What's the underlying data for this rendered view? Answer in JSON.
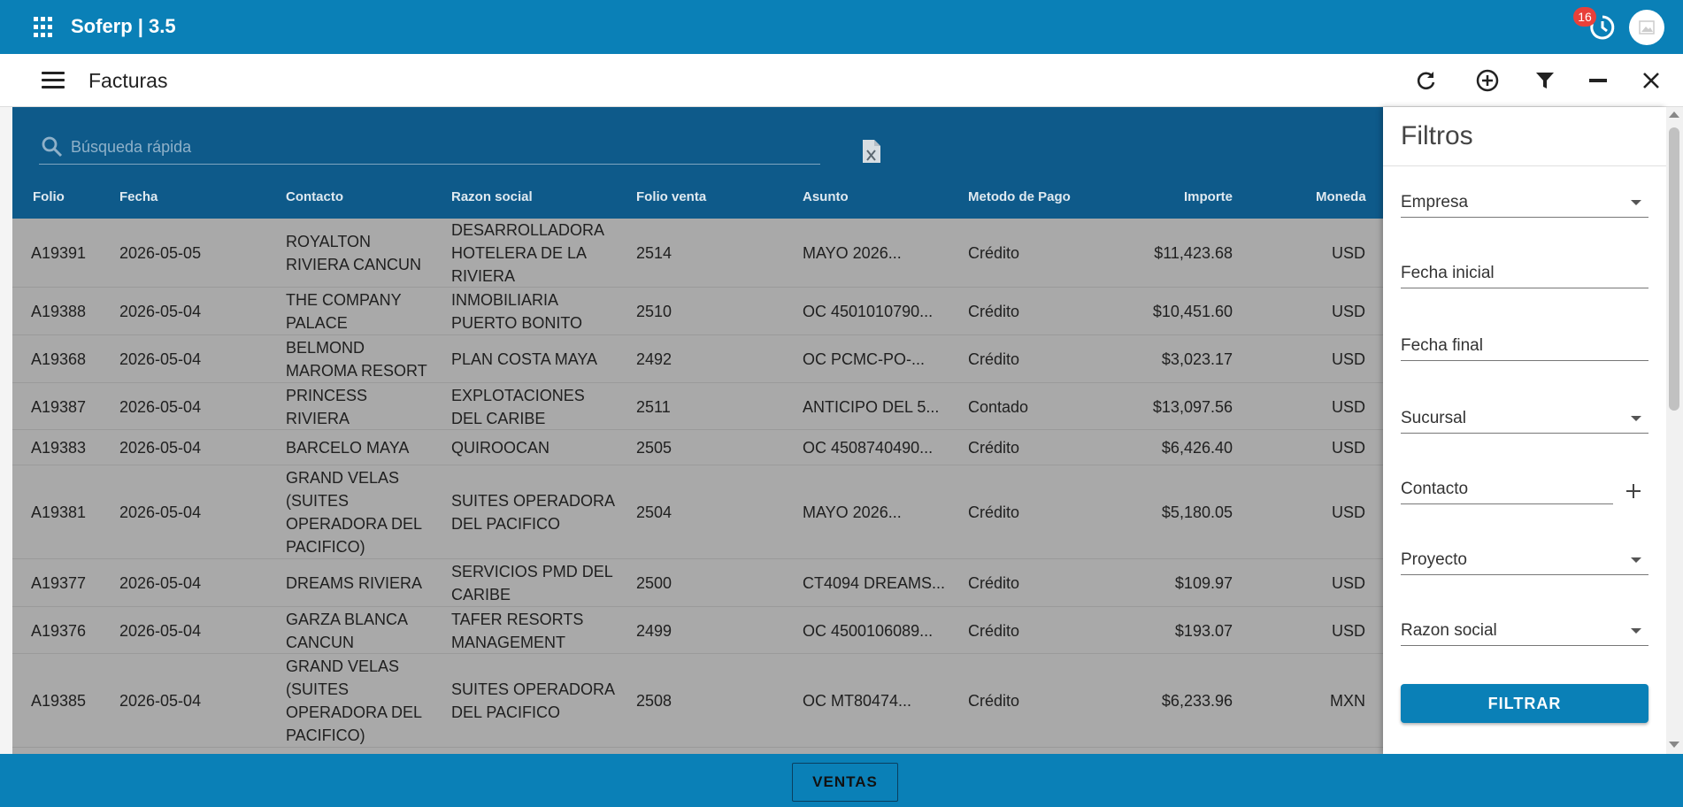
{
  "app": {
    "title": "Soferp | 3.5",
    "notification_count": "16"
  },
  "header": {
    "title": "Facturas"
  },
  "search": {
    "placeholder": "Búsqueda rápida"
  },
  "columns": [
    "Folio",
    "Fecha",
    "Contacto",
    "Razon social",
    "Folio venta",
    "Asunto",
    "Metodo de Pago",
    "Importe",
    "Moneda"
  ],
  "rows": [
    {
      "folio": "A19391",
      "fecha": "2026-05-05",
      "contacto": [
        "ROYALTON",
        "RIVIERA CANCUN"
      ],
      "razon": [
        "DESARROLLADORA",
        "HOTELERA DE LA",
        "RIVIERA"
      ],
      "folio_venta": "2514",
      "asunto": "MAYO 2026...",
      "metodo": "Crédito",
      "importe": "$11,423.68",
      "moneda": "USD"
    },
    {
      "folio": "A19388",
      "fecha": "2026-05-04",
      "contacto": [
        "THE COMPANY",
        "PALACE"
      ],
      "razon": [
        "INMOBILIARIA",
        "PUERTO BONITO"
      ],
      "folio_venta": "2510",
      "asunto": "OC 4501010790...",
      "metodo": "Crédito",
      "importe": "$10,451.60",
      "moneda": "USD"
    },
    {
      "folio": "A19368",
      "fecha": "2026-05-04",
      "contacto": [
        "BELMOND",
        "MAROMA RESORT"
      ],
      "razon": [
        "PLAN COSTA MAYA"
      ],
      "folio_venta": "2492",
      "asunto": "OC PCMC-PO-...",
      "metodo": "Crédito",
      "importe": "$3,023.17",
      "moneda": "USD"
    },
    {
      "folio": "A19387",
      "fecha": "2026-05-04",
      "contacto": [
        "PRINCESS",
        "RIVIERA"
      ],
      "razon": [
        "EXPLOTACIONES",
        "DEL CARIBE"
      ],
      "folio_venta": "2511",
      "asunto": "ANTICIPO DEL 5...",
      "metodo": "Contado",
      "importe": "$13,097.56",
      "moneda": "USD"
    },
    {
      "folio": "A19383",
      "fecha": "2026-05-04",
      "contacto": [
        "BARCELO MAYA"
      ],
      "razon": [
        "QUIROOCAN"
      ],
      "folio_venta": "2505",
      "asunto": "OC 4508740490...",
      "metodo": "Crédito",
      "importe": "$6,426.40",
      "moneda": "USD"
    },
    {
      "folio": "A19381",
      "fecha": "2026-05-04",
      "contacto": [
        "GRAND VELAS",
        "(SUITES",
        "OPERADORA DEL",
        "PACIFICO)"
      ],
      "razon": [
        "SUITES OPERADORA",
        "DEL PACIFICO"
      ],
      "folio_venta": "2504",
      "asunto": "MAYO 2026...",
      "metodo": "Crédito",
      "importe": "$5,180.05",
      "moneda": "USD"
    },
    {
      "folio": "A19377",
      "fecha": "2026-05-04",
      "contacto": [
        "DREAMS RIVIERA"
      ],
      "razon": [
        "SERVICIOS PMD DEL",
        "CARIBE"
      ],
      "folio_venta": "2500",
      "asunto": "CT4094 DREAMS...",
      "metodo": "Crédito",
      "importe": "$109.97",
      "moneda": "USD"
    },
    {
      "folio": "A19376",
      "fecha": "2026-05-04",
      "contacto": [
        "GARZA BLANCA",
        "CANCUN"
      ],
      "razon": [
        "TAFER RESORTS",
        "MANAGEMENT"
      ],
      "folio_venta": "2499",
      "asunto": "OC 4500106089...",
      "metodo": "Crédito",
      "importe": "$193.07",
      "moneda": "USD"
    },
    {
      "folio": "A19385",
      "fecha": "2026-05-04",
      "contacto": [
        "GRAND VELAS",
        "(SUITES",
        "OPERADORA DEL",
        "PACIFICO)"
      ],
      "razon": [
        "SUITES OPERADORA",
        "DEL PACIFICO"
      ],
      "folio_venta": "2508",
      "asunto": "OC MT80474...",
      "metodo": "Crédito",
      "importe": "$6,233.96",
      "moneda": "MXN"
    }
  ],
  "filters": {
    "title": "Filtros",
    "empresa": "Empresa",
    "fecha_inicial": "Fecha inicial",
    "fecha_final": "Fecha final",
    "sucursal": "Sucursal",
    "contacto": "Contacto",
    "proyecto": "Proyecto",
    "razon_social": "Razon social",
    "button": "FILTRAR"
  },
  "footer": {
    "button": "VENTAS"
  },
  "colors": {
    "primary": "#0a80b7",
    "header_dark": "#0e5a8a",
    "badge": "#e8403a",
    "overlay_row": "#a9a9a9"
  }
}
